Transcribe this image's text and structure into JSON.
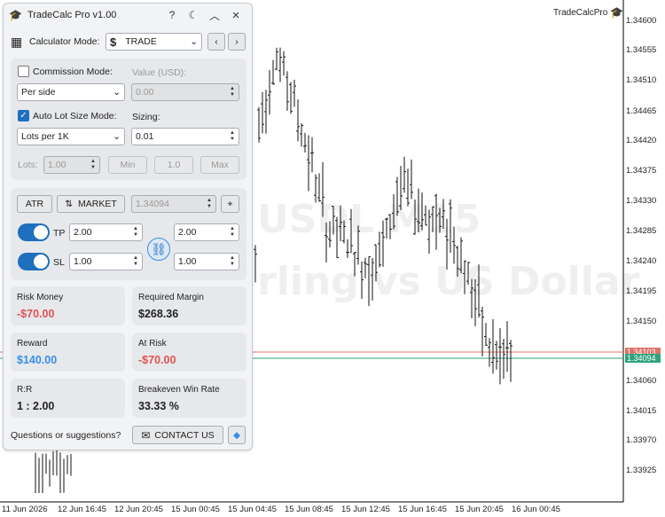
{
  "app": {
    "title": "TradeCalc Pro v1.00",
    "help": "?",
    "theme_icon": "moon-icon",
    "collapse": "^",
    "close": "×"
  },
  "mode": {
    "label": "Calculator Mode:",
    "value": "TRADE",
    "symbol": "$"
  },
  "commission": {
    "label": "Commission Mode:",
    "value_label": "Value (USD):",
    "select": "Per side",
    "value": "0.00"
  },
  "autolot": {
    "label": "Auto Lot Size Mode:",
    "sizing_label": "Sizing:",
    "select": "Lots per 1K",
    "sizing": "0.01"
  },
  "lots": {
    "label": "Lots:",
    "value": "1.00",
    "min": "Min",
    "one": "1.0",
    "max": "Max"
  },
  "entry": {
    "atr": "ATR",
    "market": "MARKET",
    "price": "1.34094"
  },
  "tp": {
    "label": "TP",
    "value": "2.00",
    "value2": "2.00"
  },
  "sl": {
    "label": "SL",
    "value": "1.00",
    "value2": "1.00"
  },
  "cards": {
    "risk_money": {
      "label": "Risk Money",
      "value": "-$70.00"
    },
    "required_margin": {
      "label": "Required Margin",
      "value": "$268.36"
    },
    "reward": {
      "label": "Reward",
      "value": "$140.00"
    },
    "at_risk": {
      "label": "At Risk",
      "value": "-$70.00"
    },
    "rr": {
      "label": "R:R",
      "value": "1 : 2.00"
    },
    "breakeven": {
      "label": "Breakeven Win Rate",
      "value": "33.33 %"
    }
  },
  "footer": {
    "question": "Questions or suggestions?",
    "contact": "CONTACT US"
  },
  "chart": {
    "name": "TradeCalcPro",
    "watermark_line1": "USDL M15",
    "watermark_line2": "rling vs US Dollar",
    "price_labels": [
      "1.34600",
      "1.34555",
      "1.34510",
      "1.34465",
      "1.34420",
      "1.34375",
      "1.34330",
      "1.34285",
      "1.34240",
      "1.34195",
      "1.34150",
      "1.34060",
      "1.34015",
      "1.33970",
      "1.33925"
    ],
    "bid": "1.34103",
    "ask": "1.34094",
    "time_labels": [
      "11 Jun 2026",
      "12 Jun 16:45",
      "12 Jun 20:45",
      "15 Jun 00:45",
      "15 Jun 04:45",
      "15 Jun 08:45",
      "15 Jun 12:45",
      "15 Jun 16:45",
      "15 Jun 20:45",
      "16 Jun 00:45"
    ],
    "colors": {
      "bid": "#e0736b",
      "ask": "#2ea27d"
    }
  }
}
